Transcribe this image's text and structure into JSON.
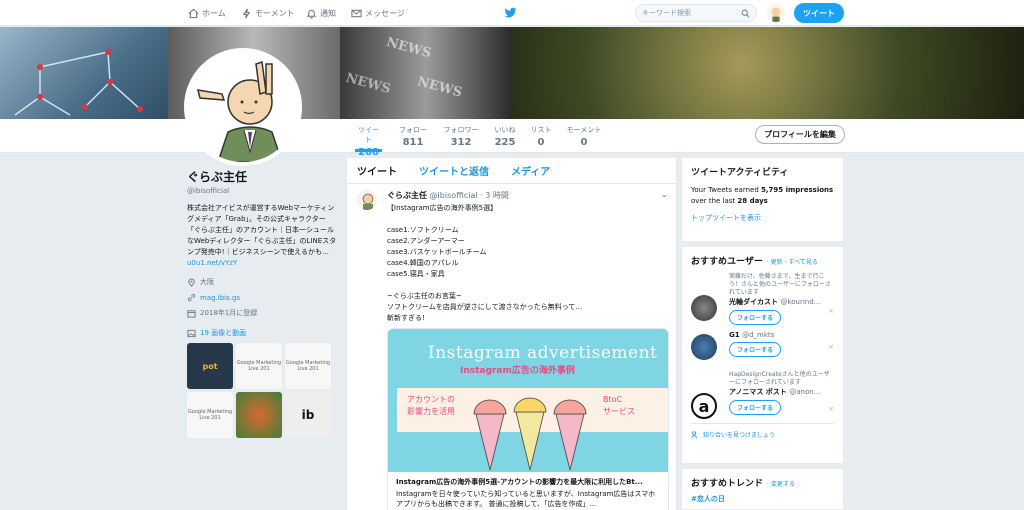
{
  "nav": {
    "home": "ホーム",
    "moments": "モーメント",
    "notifications": "通知",
    "messages": "メッセージ",
    "search_placeholder": "キーワード検索",
    "tweet_button": "ツイート"
  },
  "profile": {
    "name": "ぐらぶ主任",
    "handle": "@ibisofficial",
    "bio": "株式会社アイビスが運営するWebマーケティングメディア「Grab」。その公式キャラクター「ぐらぶ主任」のアカウント｜日本一シュールなWebディレクター「ぐらぶ主任」のLINEスタンプ発売中!｜ビジネスシーンで使えるかも…",
    "bio_link": "u0u1.net/vYzY",
    "location": "大阪",
    "website": "mag.ibis.gs",
    "joined": "2018年1月に登録",
    "photos_label": "19 画像と動画",
    "edit_button": "プロフィールを編集"
  },
  "stats": [
    {
      "label": "ツイート",
      "value": "268"
    },
    {
      "label": "フォロー",
      "value": "811"
    },
    {
      "label": "フォロワー",
      "value": "312"
    },
    {
      "label": "いいね",
      "value": "225"
    },
    {
      "label": "リスト",
      "value": "0"
    },
    {
      "label": "モーメント",
      "value": "0"
    }
  ],
  "photos": [
    {
      "label": "pot"
    },
    {
      "label": "Google Marketing Live 201"
    },
    {
      "label": "Google Marketing Live 201"
    },
    {
      "label": "Google Marketing Live 201"
    },
    {
      "label": ""
    },
    {
      "label": "ib"
    }
  ],
  "timeline_tabs": [
    "ツイート",
    "ツイートと返信",
    "メディア"
  ],
  "tweet": {
    "name": "ぐらぶ主任",
    "handle": "@ibisofficial",
    "time": "· 3 時間",
    "text": "【Instagram広告の海外事例5選】\n\ncase1.ソフトクリーム\ncase2.アンダーアーマー\ncase3.バスケットボールチーム\ncase4.韓国のアパレル\ncase5.寝具・家具\n\n~ぐらぶ主任のお言葉~\nソフトクリームを店員が逆さにして渡さなかったら無料って…\n斬新すぎる!",
    "card_title": "Instagram advertisement",
    "card_subtitle": "Instagram広告の海外事例",
    "card_box_left_1": "アカウントの",
    "card_box_left_2": "影響力を活用",
    "card_box_right_1": "BtoC",
    "card_box_right_2": "サービス",
    "card_headline": "Instagram広告の海外事例5選-アカウントの影響力を最大限に利用したBt...",
    "card_desc": "Instagramを日々使っていたら知っていると思いますが、Instagram広告はスマホアプリからも出稿できます。 普通に投稿して、「広告を作成」..."
  },
  "activity": {
    "title": "ツイートアクティビティ",
    "line1_a": "Your Tweets earned ",
    "line1_b": "5,795 impressions",
    "line2_a": "over the last ",
    "line2_b": "28 days",
    "link": "トップツイートを表示"
  },
  "who_to_follow": {
    "title": "おすすめユーザー",
    "refresh": "· 更新 · すべて見る",
    "follow_label": "フォローする",
    "users": [
      {
        "context": "実藤だけ、佐藤さまで、生まで行こう！さんと他のユーザーにフォローされています",
        "name": "光輪ダイカスト",
        "handle": "@kourind..."
      },
      {
        "context": "",
        "name": "G1",
        "handle": "@d_mkts"
      },
      {
        "context": "HapDesignCreateさんと他のユーザーにフォローされています",
        "name": "アノニマス ポスト",
        "handle": "@anon..."
      }
    ],
    "find_friends": "知り合いを見つけましょう"
  },
  "trends": {
    "title": "おすすめトレンド",
    "change": "· 変更する",
    "first": "#恋人の日"
  },
  "colors": {
    "accent": "#1da1f2",
    "background": "#e6ecf0"
  }
}
